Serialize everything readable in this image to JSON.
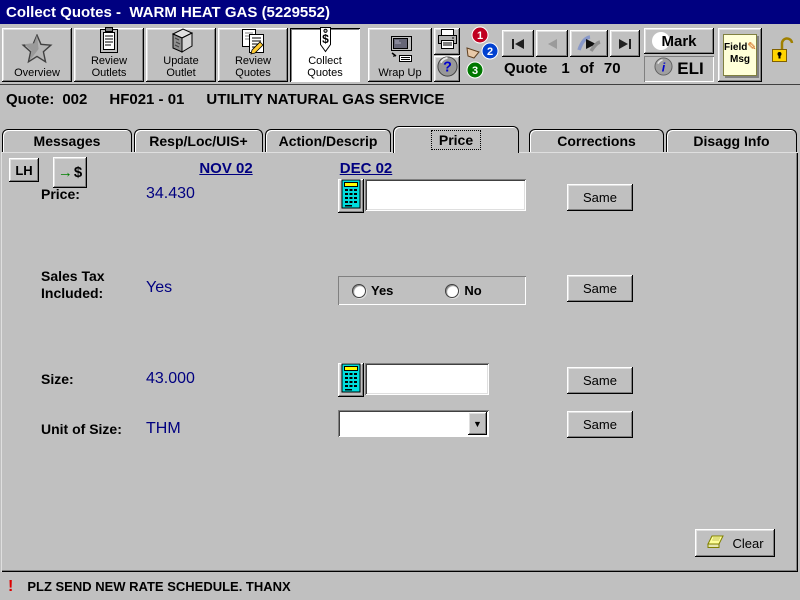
{
  "window": {
    "title": "Collect Quotes -  WARM HEAT GAS (5229552)"
  },
  "toolbar": {
    "buttons": [
      "Overview",
      "Review Outlets",
      "Update Outlet",
      "Review Quotes",
      "Collect Quotes",
      "Wrap Up"
    ],
    "help_glyph": "?",
    "quote_nav": {
      "label": "Quote",
      "current": "1",
      "of": "of",
      "total": "70"
    },
    "mark_label": "Mark",
    "eli_label": "ELI",
    "field_msg": {
      "line1": "Field",
      "line2": "Msg",
      "pencil_glyph": "✎"
    }
  },
  "quote_header": {
    "label": "Quote:",
    "number": "002",
    "item": "HF021 - 01",
    "description": "UTILITY NATURAL GAS SERVICE"
  },
  "tabs": {
    "items": [
      "Messages",
      "Resp/Loc/UIS+",
      "Action/Descrip",
      "Price",
      "Corrections",
      "Disagg Info"
    ],
    "active": "Price"
  },
  "price_panel": {
    "lh_button": "LH",
    "money_button": {
      "arrow_glyph": "→",
      "dollar_glyph": "$"
    },
    "columns": {
      "prev": "NOV 02",
      "curr": "DEC 02"
    },
    "price": {
      "label": "Price:",
      "previous": "34.430",
      "current": "",
      "same_label": "Same"
    },
    "sales_tax": {
      "label": "Sales Tax\nIncluded:",
      "previous": "Yes",
      "option_yes": "Yes",
      "option_no": "No",
      "same_label": "Same"
    },
    "size": {
      "label": "Size:",
      "previous": "43.000",
      "current": "",
      "same_label": "Same"
    },
    "unit_of_size": {
      "label": "Unit of Size:",
      "previous": "THM",
      "selected": "",
      "same_label": "Same"
    },
    "clear_label": "Clear"
  },
  "status_bar": {
    "alert_glyph": "!",
    "message": "PLZ SEND NEW RATE SCHEDULE. THANX"
  },
  "colors": {
    "title_bar": "#000080",
    "chrome": "#c0c0c0",
    "value_text": "#000080",
    "alert_red": "#dd0000",
    "calculator_cyan": "#00dddd",
    "lock_yellow": "#ffd400"
  }
}
